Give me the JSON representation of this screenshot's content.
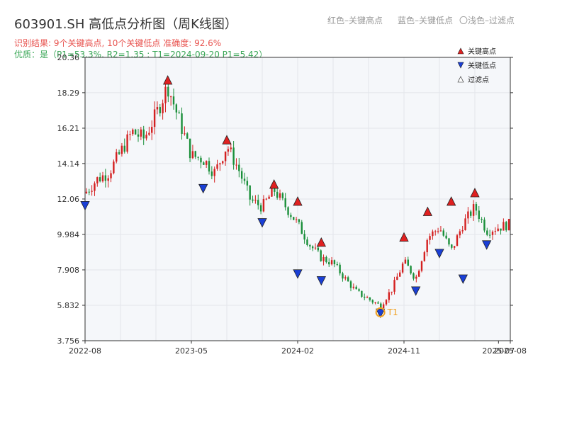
{
  "header": {
    "title": "603901.SH 高低点分析图（周K线图）",
    "legend_red": "红色–关键高点",
    "legend_blue": "蓝色–关键低点",
    "legend_light": "〇浅色–过滤点",
    "result_line": "识别结果: 9个关键高点, 10个关键低点   准确度: 92.6%",
    "quality_line": "优质：是（P1=53.3%, R2=1.35 ; T1=2024-09-20 P1=5.42）"
  },
  "chart_data": {
    "type": "candlestick",
    "ylim": [
      3.756,
      20.36
    ],
    "yticks": [
      3.756,
      5.832,
      7.908,
      9.984,
      12.06,
      14.14,
      16.21,
      18.29,
      20.36
    ],
    "ytick_labels": [
      "3.756",
      "5.832",
      "7.908",
      "9.984",
      "12.06",
      "14.14",
      "16.21",
      "18.29",
      "20.36"
    ],
    "xticks": [
      "2022-08",
      "2023-05",
      "2024-02",
      "2024-11",
      "2025-07",
      "2025-08"
    ],
    "x_start": "2022-08",
    "x_end": "2025-08",
    "series_colors": {
      "up": "#d42020",
      "down": "#1a8f3a"
    },
    "close_path": [
      [
        "2022-08",
        12.4
      ],
      [
        "2022-09",
        13.2
      ],
      [
        "2022-10",
        13.6
      ],
      [
        "2022-11",
        14.8
      ],
      [
        "2022-12",
        16.0
      ],
      [
        "2023-01",
        15.6
      ],
      [
        "2023-02",
        17.0
      ],
      [
        "2023-03",
        18.7
      ],
      [
        "2023-04",
        16.6
      ],
      [
        "2023-05",
        14.6
      ],
      [
        "2023-06",
        14.4
      ],
      [
        "2023-07",
        13.6
      ],
      [
        "2023-08",
        15.2
      ],
      [
        "2023-09",
        13.8
      ],
      [
        "2023-10",
        12.0
      ],
      [
        "2023-11",
        11.6
      ],
      [
        "2023-12",
        12.6
      ],
      [
        "2024-01",
        11.6
      ],
      [
        "2024-02",
        10.6
      ],
      [
        "2024-03",
        9.4
      ],
      [
        "2024-04",
        8.6
      ],
      [
        "2024-05",
        8.3
      ],
      [
        "2024-06",
        7.4
      ],
      [
        "2024-07",
        6.6
      ],
      [
        "2024-08",
        6.2
      ],
      [
        "2024-09",
        5.8
      ],
      [
        "2024-10",
        6.8
      ],
      [
        "2024-11",
        8.4
      ],
      [
        "2024-12",
        7.4
      ],
      [
        "2025-01",
        9.8
      ],
      [
        "2025-02",
        10.4
      ],
      [
        "2025-03",
        9.0
      ],
      [
        "2025-04",
        10.6
      ],
      [
        "2025-05",
        11.6
      ],
      [
        "2025-06",
        10.2
      ],
      [
        "2025-07",
        10.4
      ],
      [
        "2025-08",
        10.6
      ]
    ],
    "key_highs": [
      {
        "date": "2023-03",
        "value": 18.7
      },
      {
        "date": "2023-08",
        "value": 15.2
      },
      {
        "date": "2023-12",
        "value": 12.6
      },
      {
        "date": "2024-02",
        "value": 11.6
      },
      {
        "date": "2024-04",
        "value": 9.2
      },
      {
        "date": "2024-11",
        "value": 9.5
      },
      {
        "date": "2025-01",
        "value": 11.0
      },
      {
        "date": "2025-03",
        "value": 11.6
      },
      {
        "date": "2025-05",
        "value": 12.1
      }
    ],
    "key_lows": [
      {
        "date": "2022-08",
        "value": 12.0
      },
      {
        "date": "2023-06",
        "value": 13.0
      },
      {
        "date": "2023-11",
        "value": 11.0
      },
      {
        "date": "2024-02",
        "value": 8.0
      },
      {
        "date": "2024-04",
        "value": 7.6
      },
      {
        "date": "2024-09",
        "value": 5.7
      },
      {
        "date": "2024-12",
        "value": 7.0
      },
      {
        "date": "2025-02",
        "value": 9.2
      },
      {
        "date": "2025-04",
        "value": 7.7
      },
      {
        "date": "2025-06",
        "value": 9.7
      }
    ],
    "t1_marker": {
      "date": "2024-09",
      "value": 5.42,
      "label": "T1"
    },
    "legend": [
      "关键高点",
      "关键低点",
      "过滤点"
    ],
    "grid": true
  }
}
